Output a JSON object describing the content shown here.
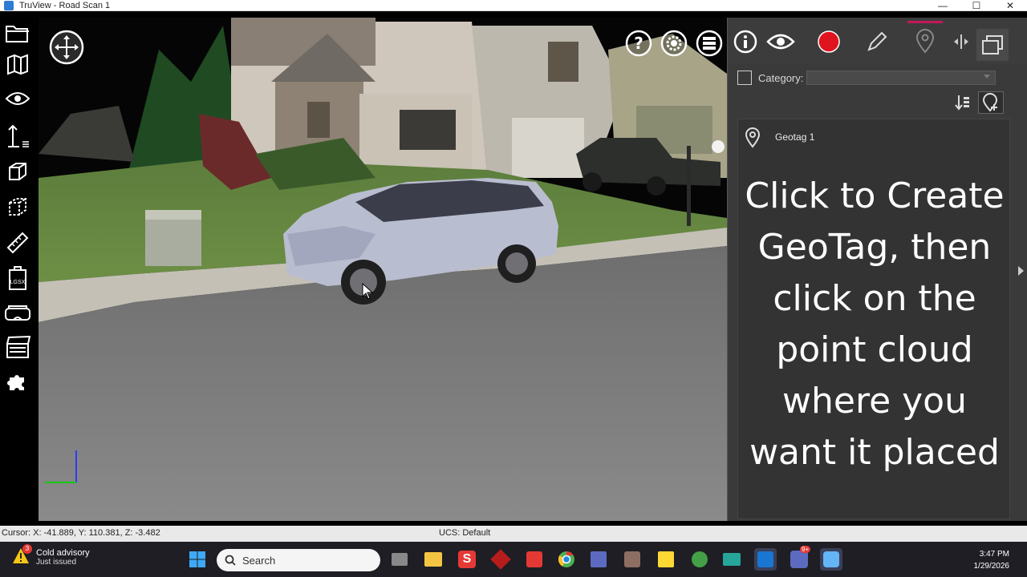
{
  "window": {
    "title": "TruView - Road Scan 1",
    "controls": [
      "—",
      "☐",
      "✕"
    ]
  },
  "left_toolbar": {
    "items": [
      {
        "name": "open-folder-icon"
      },
      {
        "name": "map-icon"
      },
      {
        "name": "eye-icon"
      },
      {
        "name": "measure-height-icon"
      },
      {
        "name": "cube-icon"
      },
      {
        "name": "box-select-icon"
      },
      {
        "name": "ruler-icon"
      },
      {
        "name": "lgsx-icon",
        "text": "LGSX"
      },
      {
        "name": "vr-headset-icon"
      },
      {
        "name": "clapperboard-icon"
      },
      {
        "name": "puzzle-icon"
      }
    ]
  },
  "viewport": {
    "icons": [
      "navigate-icon",
      "help-icon",
      "settings-icon",
      "layers-icon"
    ]
  },
  "right_panel": {
    "toolbar": [
      "info-icon",
      "eye-icon",
      "record-icon",
      "pencil-icon",
      "geotag-icon",
      "split-icon",
      "window-icon"
    ],
    "category_label": "Category:",
    "category_value": "",
    "geotags": [
      {
        "label": "Geotag 1"
      }
    ],
    "caption": "Click to Create GeoTag, then click on the point cloud where you want it placed"
  },
  "status": {
    "cursor": "Cursor: X: -41.889, Y: 110.381, Z: -3.482",
    "ucs": "UCS: Default"
  },
  "taskbar": {
    "weather_badge": "3",
    "weather_title": "Cold advisory",
    "weather_sub": "Just issued",
    "search_placeholder": "Search",
    "time": "3:47 PM",
    "date": "1/29/2026",
    "teams_badge": "9+"
  },
  "colors": {
    "record": "#e0141e",
    "accent_tab": "#c2185b",
    "panel_bg": "#3a3a3a"
  }
}
